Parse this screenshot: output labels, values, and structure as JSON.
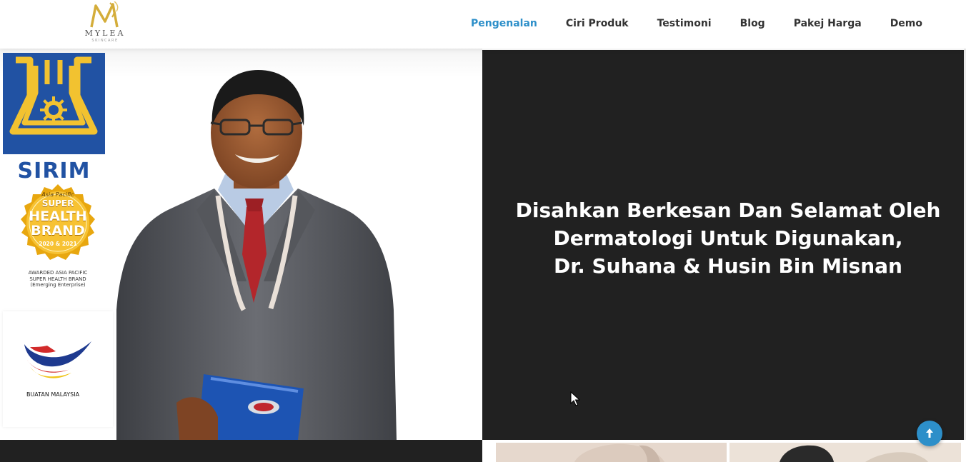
{
  "brand": {
    "name": "MYLEA",
    "subtitle": "SKINCARE",
    "accent": "#d4ad3a"
  },
  "nav": {
    "items": [
      {
        "label": "Pengenalan",
        "active": true
      },
      {
        "label": "Ciri Produk",
        "active": false
      },
      {
        "label": "Testimoni",
        "active": false
      },
      {
        "label": "Blog",
        "active": false
      },
      {
        "label": "Pakej Harga",
        "active": false
      },
      {
        "label": "Demo",
        "active": false
      }
    ],
    "active_color": "#2d8fc9"
  },
  "badges": {
    "sirim": {
      "label": "SIRIM",
      "color": "#2152a3"
    },
    "health_brand": {
      "line1": "Asia Pacific",
      "line2": "SUPER",
      "line3": "HEALTH",
      "line4": "BRAND",
      "years": "2020 & 2021",
      "caption": [
        "AWARDED ASIA PACIFIC",
        "SUPER HEALTH BRAND",
        "(Emerging Enterprise)"
      ]
    },
    "buatan_malaysia": {
      "label": "BUATAN MALAYSIA"
    }
  },
  "hero": {
    "lines": [
      "Disahkan Berkesan Dan Selamat Oleh",
      "Dermatologi Untuk Digunakan,",
      "Dr. Suhana & Husin Bin Misnan"
    ],
    "background": "#212121"
  },
  "scroll_top": {
    "icon": "arrow-up-icon",
    "color": "#2d8fc9"
  }
}
